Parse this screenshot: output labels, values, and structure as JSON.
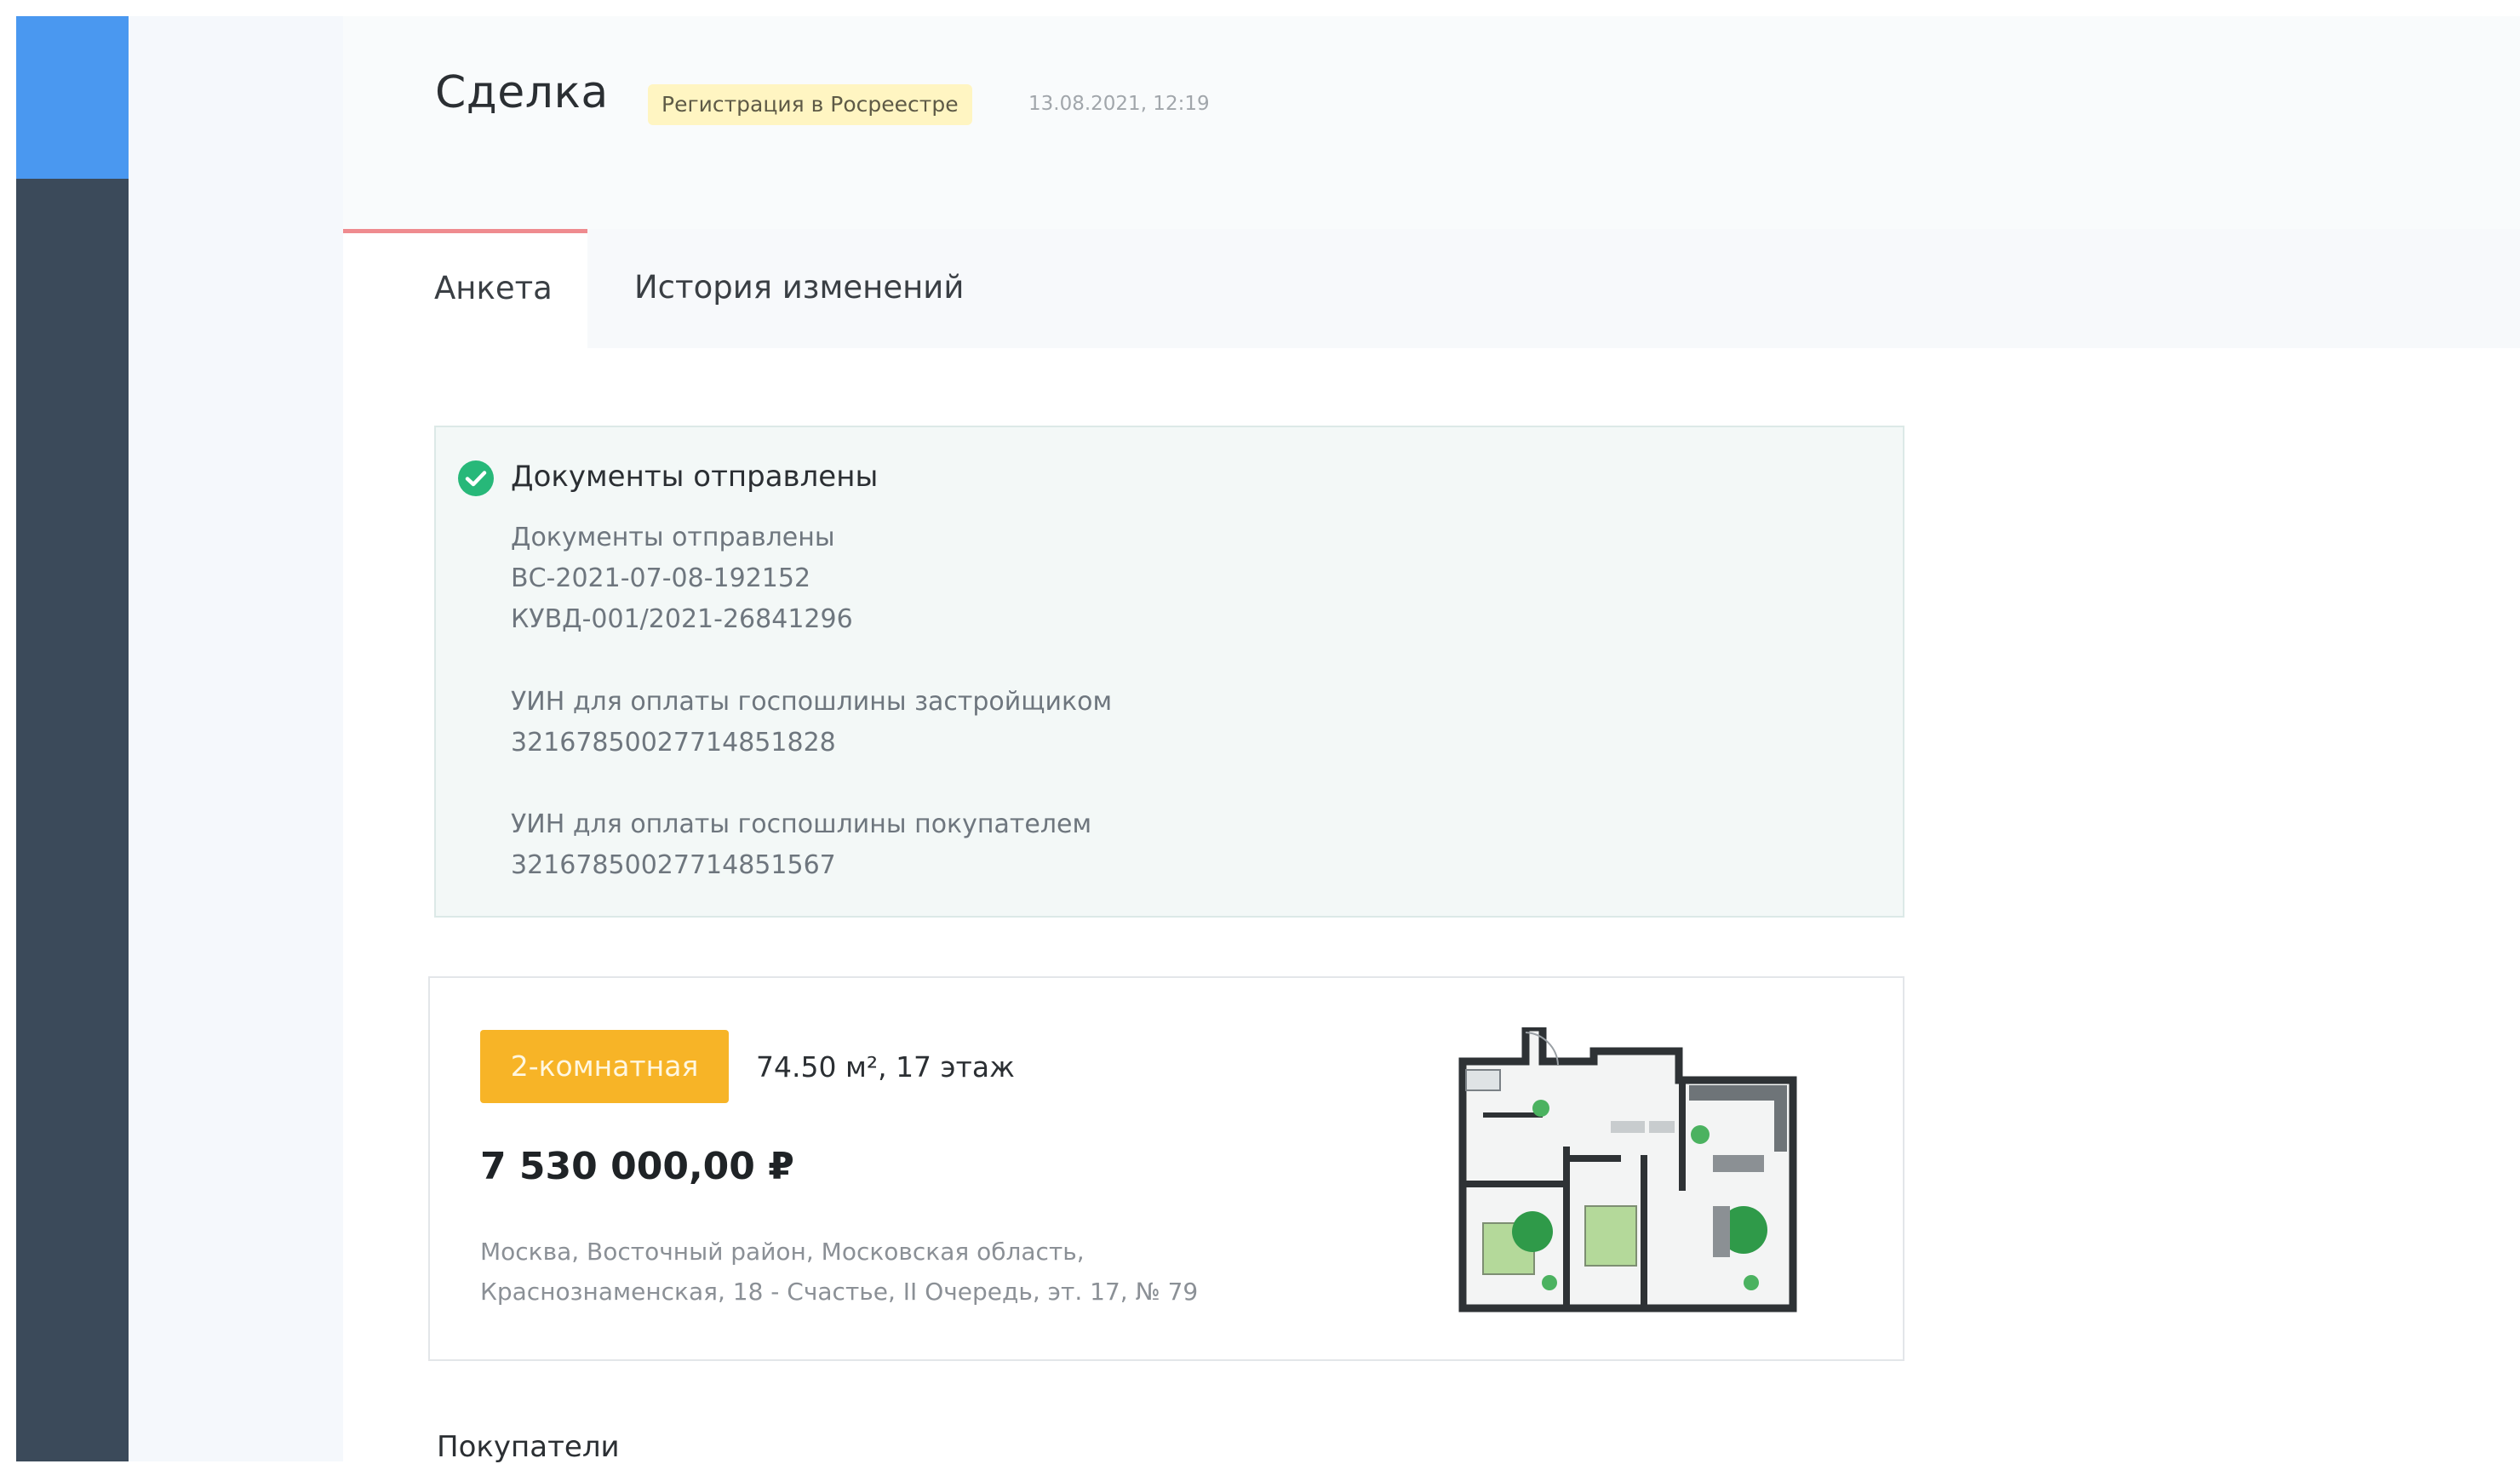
{
  "header": {
    "title": "Сделка",
    "status": "Регистрация в Росреестре",
    "timestamp": "13.08.2021, 12:19"
  },
  "tabs": [
    {
      "label": "Анкета",
      "active": true
    },
    {
      "label": "История изменений",
      "active": false
    }
  ],
  "documents": {
    "title": "Документы отправлены",
    "lines": [
      "Документы отправлены",
      "ВС-2021-07-08-192152",
      "КУВД-001/2021-26841296",
      "УИН для оплаты госпошлины застройщиком",
      "32167850027714851828",
      "УИН для оплаты госпошлины покупателем",
      "32167850027714851567"
    ]
  },
  "apartment": {
    "rooms_badge": "2-комнатная",
    "area_floor": "74.50 м², 17 этаж",
    "price": "7 530 000,00 ₽",
    "address_line1": "Москва, Восточный район, Московская область,",
    "address_line2": "Краснознаменская, 18 - Счастье, II Очередь, эт. 17, № 79"
  },
  "sections": {
    "buyers_title": "Покупатели"
  },
  "colors": {
    "sidebar": "#3b4a5a",
    "logo_block": "#4a98f0",
    "accent_tab": "#ef8b8f",
    "badge_yellow": "#fff5c2",
    "rooms_badge": "#f7b427",
    "success_green": "#27b879"
  }
}
